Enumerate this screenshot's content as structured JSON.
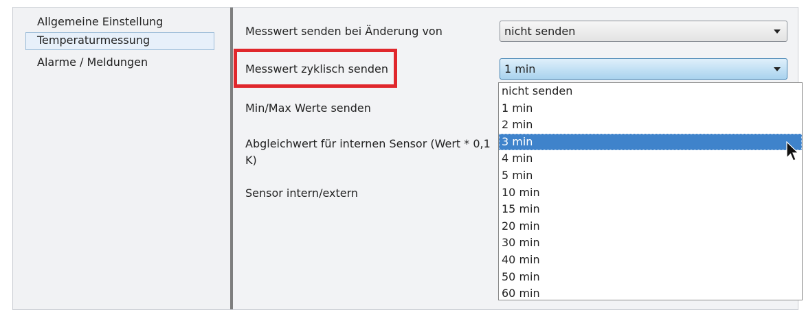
{
  "sidebar": {
    "items": [
      {
        "label": "Allgemeine Einstellung",
        "selected": false
      },
      {
        "label": "Temperaturmessung",
        "selected": true
      },
      {
        "label": "Alarme / Meldungen",
        "selected": false
      }
    ]
  },
  "params": {
    "send_on_change_label": "Messwert senden bei Änderung von",
    "send_on_change_value": "nicht senden",
    "cyclic_label": "Messwert zyklisch senden",
    "cyclic_value": "1 min",
    "minmax_label": "Min/Max Werte senden",
    "offset_label_line1": "Abgleichwert für internen Sensor (Wert * 0,1",
    "offset_label_line2": "K)",
    "sensor_label": "Sensor intern/extern"
  },
  "dropdown": {
    "options": [
      "nicht senden",
      "1 min",
      "2 min",
      "3 min",
      "4 min",
      "5 min",
      "10 min",
      "15 min",
      "20 min",
      "30 min",
      "40 min",
      "50 min",
      "60 min"
    ],
    "highlighted_index": 3
  },
  "colors": {
    "highlight_box": "#e0272c",
    "selected_option_bg": "#3f83cb"
  }
}
